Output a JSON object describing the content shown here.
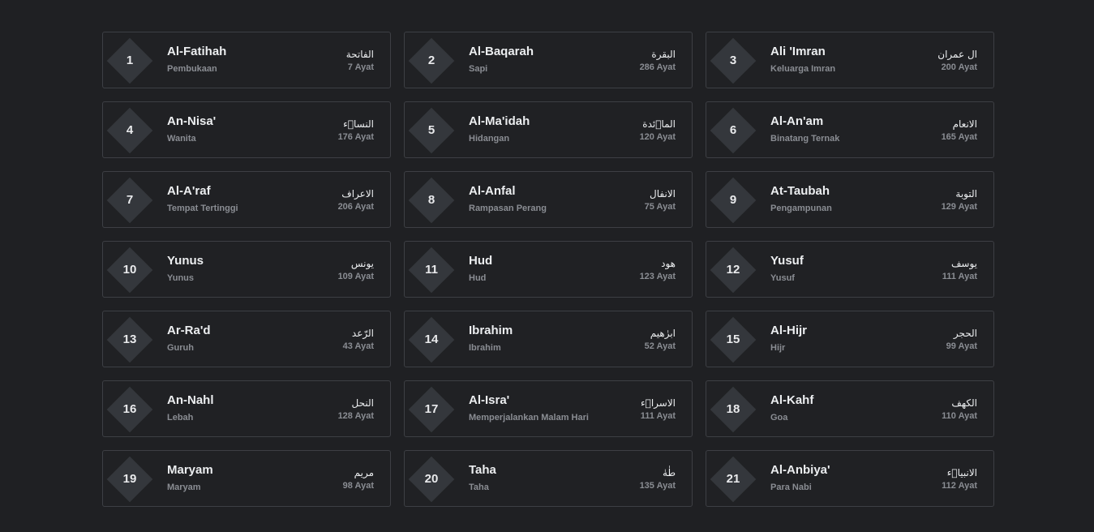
{
  "surahs": [
    {
      "number": "1",
      "name": "Al-Fatihah",
      "meaning": "Pembukaan",
      "arabic": "الفاتحة",
      "ayat": "7 Ayat"
    },
    {
      "number": "2",
      "name": "Al-Baqarah",
      "meaning": "Sapi",
      "arabic": "البقرة",
      "ayat": "286 Ayat"
    },
    {
      "number": "3",
      "name": "Ali 'Imran",
      "meaning": "Keluarga Imran",
      "arabic": "ال عمران",
      "ayat": "200 Ayat"
    },
    {
      "number": "4",
      "name": "An-Nisa'",
      "meaning": "Wanita",
      "arabic": "النساۤء",
      "ayat": "176 Ayat"
    },
    {
      "number": "5",
      "name": "Al-Ma'idah",
      "meaning": "Hidangan",
      "arabic": "الماۤئدة",
      "ayat": "120 Ayat"
    },
    {
      "number": "6",
      "name": "Al-An'am",
      "meaning": "Binatang Ternak",
      "arabic": "الانعام",
      "ayat": "165 Ayat"
    },
    {
      "number": "7",
      "name": "Al-A'raf",
      "meaning": "Tempat Tertinggi",
      "arabic": "الاعراف",
      "ayat": "206 Ayat"
    },
    {
      "number": "8",
      "name": "Al-Anfal",
      "meaning": "Rampasan Perang",
      "arabic": "الانفال",
      "ayat": "75 Ayat"
    },
    {
      "number": "9",
      "name": "At-Taubah",
      "meaning": "Pengampunan",
      "arabic": "التوبة",
      "ayat": "129 Ayat"
    },
    {
      "number": "10",
      "name": "Yunus",
      "meaning": "Yunus",
      "arabic": "يونس",
      "ayat": "109 Ayat"
    },
    {
      "number": "11",
      "name": "Hud",
      "meaning": "Hud",
      "arabic": "هود",
      "ayat": "123 Ayat"
    },
    {
      "number": "12",
      "name": "Yusuf",
      "meaning": "Yusuf",
      "arabic": "يوسف",
      "ayat": "111 Ayat"
    },
    {
      "number": "13",
      "name": "Ar-Ra'd",
      "meaning": "Guruh",
      "arabic": "الرّعد",
      "ayat": "43 Ayat"
    },
    {
      "number": "14",
      "name": "Ibrahim",
      "meaning": "Ibrahim",
      "arabic": "ابرٰهيم",
      "ayat": "52 Ayat"
    },
    {
      "number": "15",
      "name": "Al-Hijr",
      "meaning": "Hijr",
      "arabic": "الحجر",
      "ayat": "99 Ayat"
    },
    {
      "number": "16",
      "name": "An-Nahl",
      "meaning": "Lebah",
      "arabic": "النحل",
      "ayat": "128 Ayat"
    },
    {
      "number": "17",
      "name": "Al-Isra'",
      "meaning": "Memperjalankan Malam Hari",
      "arabic": "الاسراۤء",
      "ayat": "111 Ayat"
    },
    {
      "number": "18",
      "name": "Al-Kahf",
      "meaning": "Goa",
      "arabic": "الكهف",
      "ayat": "110 Ayat"
    },
    {
      "number": "19",
      "name": "Maryam",
      "meaning": "Maryam",
      "arabic": "مريم",
      "ayat": "98 Ayat"
    },
    {
      "number": "20",
      "name": "Taha",
      "meaning": "Taha",
      "arabic": "طٰهٰ",
      "ayat": "135 Ayat"
    },
    {
      "number": "21",
      "name": "Al-Anbiya'",
      "meaning": "Para Nabi",
      "arabic": "الانبياۤء",
      "ayat": "112 Ayat"
    }
  ]
}
